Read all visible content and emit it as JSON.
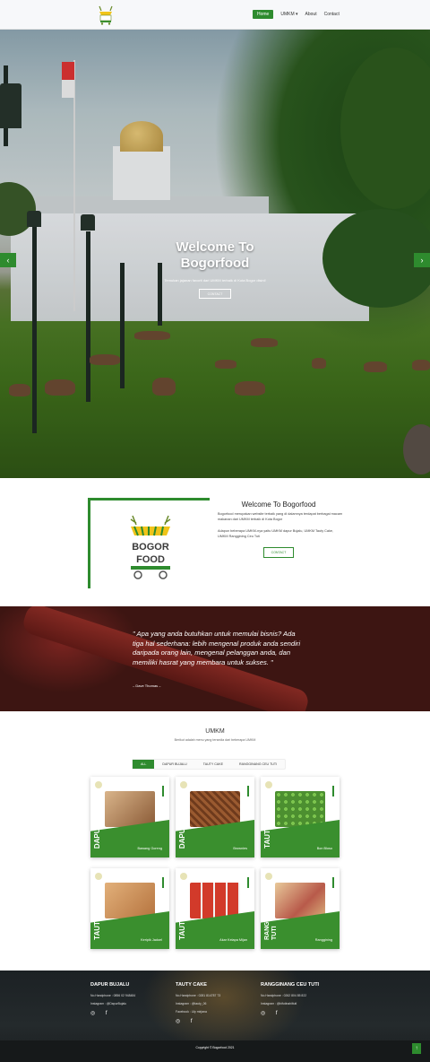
{
  "nav": {
    "items": [
      {
        "label": "Home",
        "active": true
      },
      {
        "label": "UMKM ▾",
        "active": false
      },
      {
        "label": "About",
        "active": false
      },
      {
        "label": "Contact",
        "active": false
      }
    ]
  },
  "hero": {
    "title_line1": "Welcome To",
    "title_line2": "Bogorfood",
    "subtitle": "Temukan jajanan favorit dari UMKM terbaik di Kota Bogor disini!",
    "button": "CONTACT",
    "prev": "‹",
    "next": "›"
  },
  "about": {
    "title": "Welcome To Bogorfood",
    "para1": "Bogorfood merupakan website terbaik yang di dalamnya terdapat berbagai macam makanan dari UMKM terbaik di Kota Bogor",
    "para2": "Adapun beberapa UMKM-nya yaitu UMKM dapur Bujalu, UMKM Tauty Cake, UMKM Ranggining Ceu Tuti",
    "button": "CONTACT",
    "logo_line1": "BOGOR",
    "logo_line2": "FOOD"
  },
  "quote": {
    "text": "\" Apa yang anda butuhkan untuk memulai bisnis? Ada tiga hal sederhana: lebih mengenal produk anda sendiri daripada orang lain, mengenal pelanggan anda, dan memiliki hasrat yang membara untuk sukses. \"",
    "author": "– Dave Thomas –"
  },
  "umkm": {
    "title": "UMKM",
    "subtitle": "Berikut adalah menu yang tersedia dari beberapa UMKM",
    "filters": [
      {
        "label": "ALL",
        "active": true
      },
      {
        "label": "DAPUR BUJALU",
        "active": false
      },
      {
        "label": "TAUTY CAKE",
        "active": false
      },
      {
        "label": "RANGGINANG CEU TUTI",
        "active": false
      }
    ],
    "products": [
      {
        "brand": "DAPUR BUJALU",
        "name": "Bawang Goreng",
        "photo": "#b8865a"
      },
      {
        "brand": "DAPUR BUJALU",
        "name": "Brownies",
        "photo": "#8a5230"
      },
      {
        "brand": "TAUTY CAKE",
        "name": "Bon Bloso",
        "photo": "#6fb34a"
      },
      {
        "brand": "TAUTY CAKE",
        "name": "Keripik Jadoel",
        "photo": "#c58a52"
      },
      {
        "brand": "TAUTY CAKE",
        "name": "Akar Kelapa Mijan",
        "photo": "#c23a2e"
      },
      {
        "brand": "RANGGINANG CEU TUTI",
        "name": "Ranggining",
        "photo": "#d4aa7a"
      }
    ]
  },
  "footer": {
    "cols": [
      {
        "title": "DAPUR BUJALU",
        "lines": [
          "No.Handphone : 0856 02 948484",
          "Instagram : @DapurBujalu"
        ]
      },
      {
        "title": "TAUTY CAKE",
        "lines": [
          "No.Handphone : 0281 814787 73",
          "Instagram : @tauty_06",
          "Facebook : Lily mirjana"
        ]
      },
      {
        "title": "RANGGINANG CEU TUTI",
        "lines": [
          "No.Handphone : 0262 804 85 822",
          "Instagram : @bifutinahiltutl"
        ]
      }
    ],
    "social": "◎ f",
    "copyright": "Copyright © Bogorfood 2021",
    "totop": "↑"
  },
  "colors": {
    "accent": "#2e8b2e"
  }
}
